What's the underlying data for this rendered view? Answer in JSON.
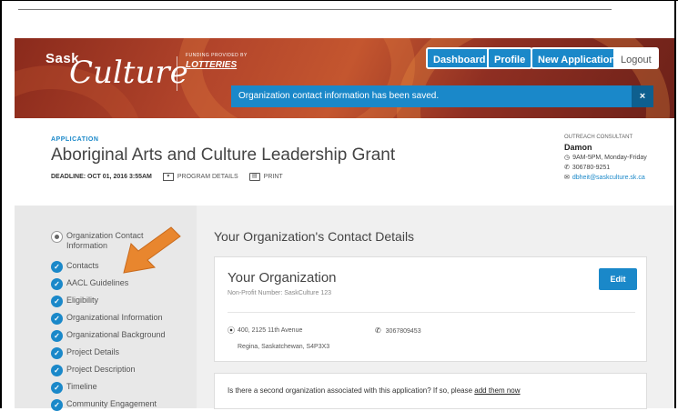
{
  "header": {
    "logo_sask": "Sask",
    "logo_culture": "Culture",
    "funding_text": "FUNDING PROVIDED BY",
    "lotteries_text": "LOTTERIES",
    "nav": {
      "dashboard": "Dashboard",
      "profile": "Profile",
      "new_application": "New Application",
      "logout": "Logout"
    },
    "toast": {
      "message": "Organization contact information has been saved.",
      "close": "×"
    }
  },
  "application": {
    "kicker": "APPLICATION",
    "title": "Aboriginal Arts and Culture Leadership Grant",
    "deadline": "DEADLINE: OCT 01, 2016 3:55AM",
    "program_details": "PROGRAM DETAILS",
    "print": "PRINT"
  },
  "consultant": {
    "kicker": "OUTREACH CONSULTANT",
    "name": "Damon",
    "hours": "9AM-5PM, Monday-Friday",
    "phone": "306780-9251",
    "email": "dbheit@saskculture.sk.ca"
  },
  "sidebar": {
    "items": [
      {
        "label": "Organization Contact",
        "label2": "Information",
        "state": "current"
      },
      {
        "label": "Contacts",
        "state": "done"
      },
      {
        "label": "AACL Guidelines",
        "state": "done"
      },
      {
        "label": "Eligibility",
        "state": "done"
      },
      {
        "label": "Organizational Information",
        "state": "done"
      },
      {
        "label": "Organizational Background",
        "state": "done"
      },
      {
        "label": "Project Details",
        "state": "done"
      },
      {
        "label": "Project Description",
        "state": "done"
      },
      {
        "label": "Timeline",
        "state": "done"
      },
      {
        "label": "Community Engagement",
        "state": "done"
      }
    ]
  },
  "main": {
    "section_title": "Your Organization's Contact Details",
    "org_card": {
      "name": "Your Organization",
      "nonprofit": "Non-Profit Number: SaskCulture 123",
      "edit": "Edit",
      "address_line1": "400, 2125 11th Avenue",
      "address_line2": "Regina, Saskatchewan, S4P3X3",
      "phone": "3067809453"
    },
    "second_org": {
      "question": "Is there a second organization associated with this application? If so, please ",
      "link": "add them now"
    }
  },
  "colors": {
    "accent": "#1a88c9",
    "banner": "#b3452b",
    "arrow": "#e8862e"
  }
}
